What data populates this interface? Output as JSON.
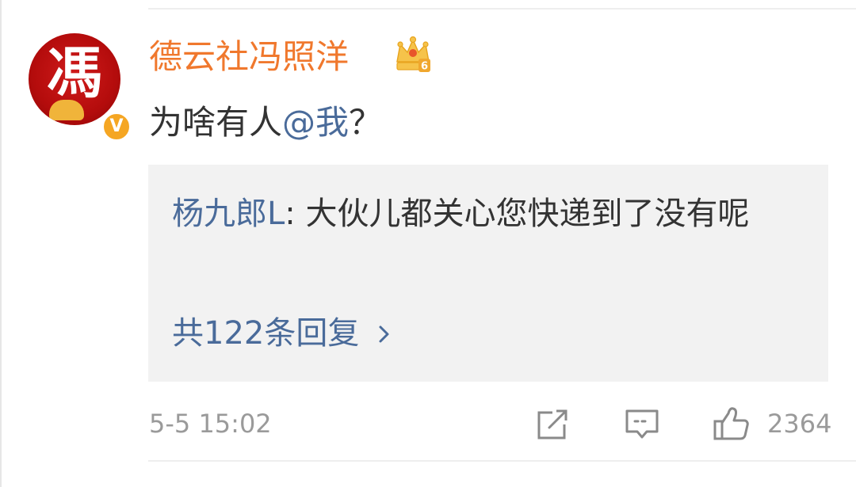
{
  "post": {
    "avatar_glyph": "馮",
    "verified_mark": "V",
    "username": "德云社冯照洋",
    "crown_level": "6",
    "comment_prefix": "为啥有人",
    "comment_mention": "@我",
    "comment_suffix": "？",
    "reply": {
      "user": "杨九郎L",
      "separator": ": ",
      "text": "大伙儿都关心您快递到了没有呢",
      "count_label": "共122条回复"
    },
    "timestamp": "5-5 15:02",
    "like_count": "2364"
  },
  "colors": {
    "username": "#f0782d",
    "link": "#4a6b9a",
    "meta": "#9a9a9a",
    "reply_bg": "#f2f2f2"
  },
  "icons": {
    "crown": "crown-level-icon",
    "share": "share-icon",
    "comment": "comment-icon",
    "like": "thumbs-up-icon",
    "chevron": "chevron-right-icon"
  }
}
